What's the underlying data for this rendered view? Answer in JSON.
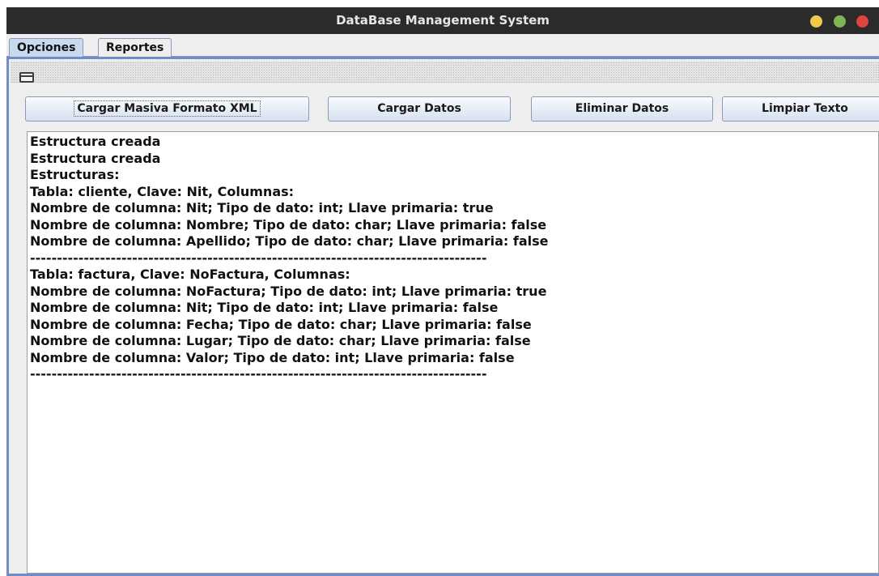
{
  "window": {
    "title": "DataBase Management System"
  },
  "tabs": [
    {
      "label": "Opciones",
      "active": true
    },
    {
      "label": "Reportes",
      "active": false
    }
  ],
  "buttons": {
    "cargar_masiva": "Cargar Masiva Formato XML",
    "cargar_datos": "Cargar Datos",
    "eliminar_datos": "Eliminar Datos",
    "limpiar_texto": "Limpiar Texto"
  },
  "output": {
    "lines": [
      "Estructura creada",
      "Estructura creada",
      "Estructuras:",
      "Tabla: cliente, Clave: Nit, Columnas:",
      "Nombre de columna: Nit; Tipo de dato: int; Llave primaria: true",
      "Nombre de columna: Nombre; Tipo de dato: char; Llave primaria: false",
      "Nombre de columna: Apellido; Tipo de dato: char; Llave primaria: false",
      "-------------------------------------------------------------------------------------",
      "Tabla: factura, Clave: NoFactura, Columnas:",
      "Nombre de columna: NoFactura; Tipo de dato: int; Llave primaria: true",
      "Nombre de columna: Nit; Tipo de dato: int; Llave primaria: false",
      "Nombre de columna: Fecha; Tipo de dato: char; Llave primaria: false",
      "Nombre de columna: Lugar; Tipo de dato: char; Llave primaria: false",
      "Nombre de columna: Valor; Tipo de dato: int; Llave primaria: false",
      "-------------------------------------------------------------------------------------"
    ]
  },
  "colors": {
    "titlebar": "#2b2b2b",
    "frame_border": "#6f8ec8",
    "active_tab": "#c9d9ee",
    "minimize": "#f0c94a",
    "maximize": "#7fb654",
    "close": "#e0443e"
  },
  "icons": {
    "window_controls": [
      "minimize-icon",
      "maximize-icon",
      "close-icon"
    ],
    "internal_frame": "internal-window-icon"
  }
}
